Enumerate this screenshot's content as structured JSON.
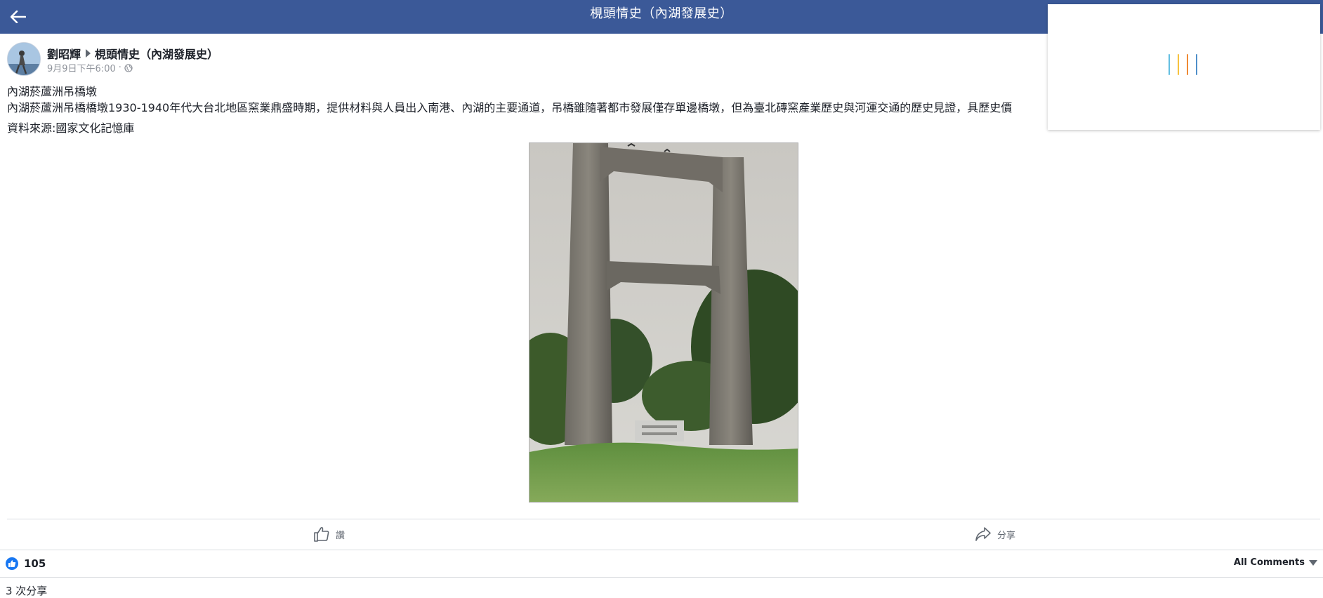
{
  "topbar": {
    "title": "梘頭情史（內湖發展史）",
    "back_icon": "arrow-left-icon",
    "color": "#3b5998"
  },
  "loader": {
    "icon": "loading-bars-icon",
    "colors": [
      "#63bfe1",
      "#f7c23e",
      "#ef8a34",
      "#4f8fc9"
    ]
  },
  "post": {
    "author": "劉昭輝",
    "group": "梘頭情史（內湖發展史）",
    "timestamp": "9月9日下午6:00",
    "separator": "·",
    "privacy_icon": "globe-icon",
    "text_lines": [
      "內湖菸蘆洲吊橋墩",
      "內湖菸蘆洲吊橋橋墩1930-1940年代大台北地區窯業鼎盛時期，提供材料與人員出入南港、內湖的主要通道，吊橋雖隨著都市發展僅存單邊橋墩，但為臺北磚窯產業歷史與河運交通的歷史見證，具歷史價"
    ],
    "source": "資料來源:國家文化記憶庫"
  },
  "actions": {
    "like_label": "讚",
    "share_label": "分享"
  },
  "stats": {
    "like_count": "105",
    "comments_filter": "All Comments",
    "shares": "3 次分享"
  }
}
